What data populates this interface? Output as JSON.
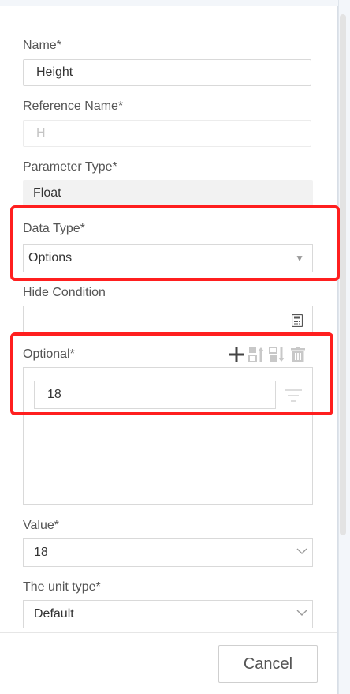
{
  "form": {
    "name": {
      "label": "Name*",
      "value": "Height"
    },
    "reference_name": {
      "label": "Reference Name*",
      "placeholder": "H"
    },
    "parameter_type": {
      "label": "Parameter Type*",
      "value": "Float"
    },
    "data_type": {
      "label": "Data Type*",
      "value": "Options"
    },
    "hide_condition": {
      "label": "Hide Condition"
    },
    "optional": {
      "label": "Optional*",
      "option_value": "18"
    },
    "value": {
      "label": "Value*",
      "value": "18"
    },
    "unit_type": {
      "label": "The unit type*",
      "value": "Default"
    }
  },
  "footer": {
    "cancel_label": "Cancel"
  },
  "icons": {
    "calculator": "calculator-icon",
    "add": "plus-icon",
    "move_up": "move-up-icon",
    "move_down": "move-down-icon",
    "delete": "trash-icon",
    "filter": "filter-icon",
    "dropdown_caret": "caret-down-icon",
    "dropdown_chevron": "chevron-down-icon"
  },
  "colors": {
    "highlight": "#ff1f1f"
  }
}
